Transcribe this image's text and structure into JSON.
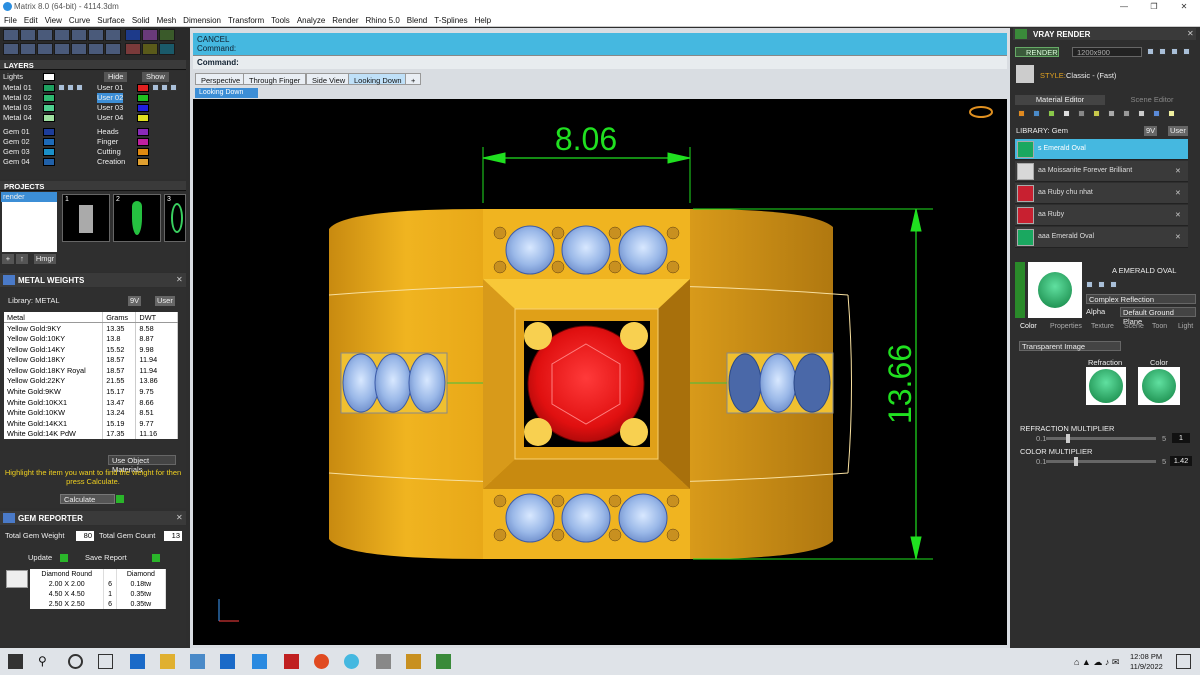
{
  "window": {
    "title": "Matrix 8.0 (64-bit) - 4114.3dm"
  },
  "menu": [
    "File",
    "Edit",
    "View",
    "Curve",
    "Surface",
    "Solid",
    "Mesh",
    "Dimension",
    "Transform",
    "Tools",
    "Analyze",
    "Render",
    "Rhino 5.0",
    "Blend",
    "T-Splines",
    "Help"
  ],
  "layers": {
    "title": "LAYERS",
    "lights_label": "Lights",
    "hide_label": "Hide",
    "show_label": "Show",
    "left": [
      {
        "name": "Metal 01",
        "color": "#1fa060"
      },
      {
        "name": "Metal 02",
        "color": "#2fb870"
      },
      {
        "name": "Metal 03",
        "color": "#4fcf8f"
      },
      {
        "name": "Metal 04",
        "color": "#9fe0a0"
      },
      {
        "name": "Gem 01",
        "color": "#1d3d9a"
      },
      {
        "name": "Gem 02",
        "color": "#1d6ab8"
      },
      {
        "name": "Gem 03",
        "color": "#1a8fc8"
      },
      {
        "name": "Gem 04",
        "color": "#2060a8"
      }
    ],
    "right": [
      {
        "name": "User 01",
        "color": "#e02020"
      },
      {
        "name": "User 02",
        "color": "#20c020"
      },
      {
        "name": "User 03",
        "color": "#2020e0"
      },
      {
        "name": "User 04",
        "color": "#e0e020"
      },
      {
        "name": "Heads",
        "color": "#8a2ab8"
      },
      {
        "name": "Finger",
        "color": "#c020a0"
      },
      {
        "name": "Cutting",
        "color": "#e08a10"
      },
      {
        "name": "Creation",
        "color": "#e0a030"
      }
    ]
  },
  "projects": {
    "title": "PROJECTS",
    "item": "render",
    "thumbs": [
      "1",
      "2",
      "3"
    ],
    "buttons": [
      "+",
      "↑",
      "Hmgr"
    ]
  },
  "metal_weights": {
    "title": "METAL WEIGHTS",
    "library": "Library: METAL",
    "lib_btns": [
      "9V",
      "User"
    ],
    "headers": [
      "Metal",
      "Grams",
      "DWT"
    ],
    "rows": [
      [
        "Yellow Gold:9KY",
        "13.35",
        "8.58"
      ],
      [
        "Yellow Gold:10KY",
        "13.8",
        "8.87"
      ],
      [
        "Yellow Gold:14KY",
        "15.52",
        "9.98"
      ],
      [
        "Yellow Gold:18KY",
        "18.57",
        "11.94"
      ],
      [
        "Yellow Gold:18KY Royal",
        "18.57",
        "11.94"
      ],
      [
        "Yellow Gold:22KY",
        "21.55",
        "13.86"
      ],
      [
        "White Gold:9KW",
        "15.17",
        "9.75"
      ],
      [
        "White Gold:10KX1",
        "13.47",
        "8.66"
      ],
      [
        "White Gold:10KW",
        "13.24",
        "8.51"
      ],
      [
        "White Gold:14KX1",
        "15.19",
        "9.77"
      ],
      [
        "White Gold:14K PdW",
        "17.35",
        "11.16"
      ]
    ],
    "use_obj": "Use Object Materials",
    "hint": "Highlight the item you want to find the weight for then press Calculate.",
    "calc": "Calculate"
  },
  "gem_reporter": {
    "title": "GEM REPORTER",
    "total_weight_label": "Total Gem Weight",
    "total_weight": "80",
    "total_count_label": "Total Gem Count",
    "total_count": "13",
    "update": "Update",
    "save": "Save Report",
    "headers": [
      "Diamond Round",
      "",
      "Diamond"
    ],
    "rows": [
      [
        "2.00 X 2.00",
        "6",
        "0.18tw"
      ],
      [
        "4.50 X 4.50",
        "1",
        "0.35tw"
      ],
      [
        "2.50 X 2.50",
        "6",
        "0.35tw"
      ]
    ]
  },
  "command": {
    "line1": "CANCEL",
    "line2": "Command:",
    "prompt": "Command:"
  },
  "viewport_tabs": [
    "Perspective",
    "Through Finger",
    "Side View",
    "Looking Down",
    "+"
  ],
  "active_view": "Looking Down",
  "dimensions": {
    "width": "8.06",
    "height": "13.66"
  },
  "vray": {
    "title": "VRAY RENDER",
    "render_btn": "RENDER",
    "resolution": "1200x900",
    "style_label": "STYLE:",
    "style_value": "Classic - (Fast)",
    "tabs": [
      "Material Editor",
      "Scene Editor"
    ],
    "library": "LIBRARY: Gem",
    "lib_btns": [
      "9V",
      "User"
    ],
    "materials": [
      {
        "name": "s Emerald Oval",
        "color": "#1aa860"
      },
      {
        "name": "aa Moissanite Forever Brilliant",
        "color": "#d8d8d8"
      },
      {
        "name": "aa Ruby chu nhat",
        "color": "#c82030"
      },
      {
        "name": "aa Ruby",
        "color": "#c82030"
      },
      {
        "name": "aaa Emerald Oval",
        "color": "#1aa860"
      }
    ],
    "selected_name": "A EMERALD OVAL",
    "reflection": "Complex Reflection",
    "alpha": "Alpha",
    "ground": "Default Ground Plane",
    "sub_tabs": [
      "Color",
      "Properties",
      "Texture",
      "Scene",
      "Toon",
      "Light"
    ],
    "trans_image": "Transparent Image",
    "refraction": "Refraction",
    "color": "Color",
    "refr_mult_label": "REFRACTION MULTIPLIER",
    "refr_min": "0.1",
    "refr_max": "5",
    "refr_val": "1",
    "color_mult_label": "COLOR MULTIPLIER",
    "col_min": "0.1",
    "col_max": "5",
    "col_val": "1.42"
  },
  "taskbar": {
    "time": "12:08 PM",
    "date": "11/9/2022"
  }
}
